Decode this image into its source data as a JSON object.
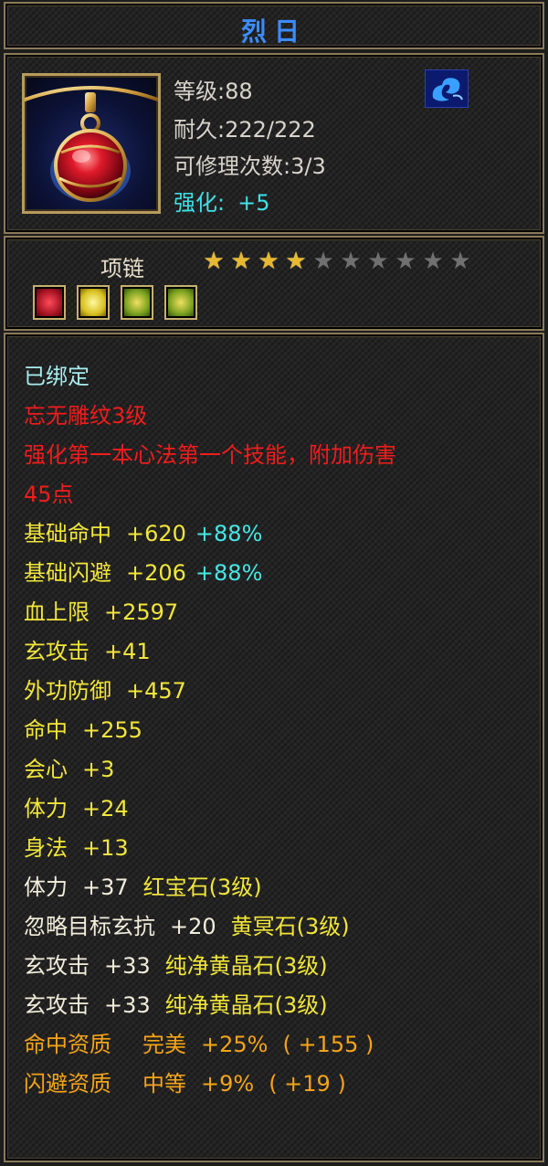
{
  "title": "烈日",
  "header": {
    "level_label": "等级:",
    "level": "88",
    "durability_label": "耐久:",
    "durability": "222/222",
    "repair_label": "可修理次数:",
    "repair": "3/3",
    "enhance_label": "强化:",
    "enhance": "+5",
    "item_icon": "necklace-ruby-icon",
    "class_icon": "blue-cloud-emblem-icon"
  },
  "sub": {
    "type": "项链",
    "stars_filled": 4,
    "stars_total": 10,
    "gem_icons": [
      "red-gem-icon",
      "yellow-gem-icon",
      "green-gold-gem-icon",
      "green-gold-gem-icon"
    ]
  },
  "attributes": {
    "bound": "已绑定",
    "engraving": "忘无雕纹3级",
    "effect_line1": "强化第一本心法第一个技能，附加伤害",
    "effect_line2": "45点",
    "base_hit_label": "基础命中",
    "base_hit_value": "+620",
    "base_hit_pct": "+88%",
    "base_dodge_label": "基础闪避",
    "base_dodge_value": "+206",
    "base_dodge_pct": "+88%",
    "hp_label": "血上限",
    "hp_value": "+2597",
    "xuan_label": "玄攻击",
    "xuan_value": "+41",
    "def_label": "外功防御",
    "def_value": "+457",
    "hit_label": "命中",
    "hit_value": "+255",
    "crit_label": "会心",
    "crit_value": "+3",
    "sta_label": "体力",
    "sta_value": "+24",
    "agi_label": "身法",
    "agi_value": "+13",
    "gem1_stat": "体力",
    "gem1_value": "+37",
    "gem1_name": "红宝石(3级)",
    "gem2_stat": "忽略目标玄抗",
    "gem2_value": "+20",
    "gem2_name": "黄冥石(3级)",
    "gem3_stat": "玄攻击",
    "gem3_value": "+33",
    "gem3_name": "纯净黄晶石(3级)",
    "gem4_stat": "玄攻击",
    "gem4_value": "+33",
    "gem4_name": "纯净黄晶石(3级)",
    "apt1_label": "命中资质",
    "apt1_grade": "完美",
    "apt1_pct": "+25%",
    "apt1_bonus": "( +155 )",
    "apt2_label": "闪避资质",
    "apt2_grade": "中等",
    "apt2_pct": "+9%",
    "apt2_bonus": "( +19 )"
  },
  "colors": {
    "title": "#3b8cff",
    "enhance": "#3ee0e8",
    "bound": "#a8ecec",
    "engraving": "#f01c1c",
    "stats": "#f2e63a",
    "aptitude": "#f4a418",
    "bonus_pct": "#48e6e6"
  }
}
